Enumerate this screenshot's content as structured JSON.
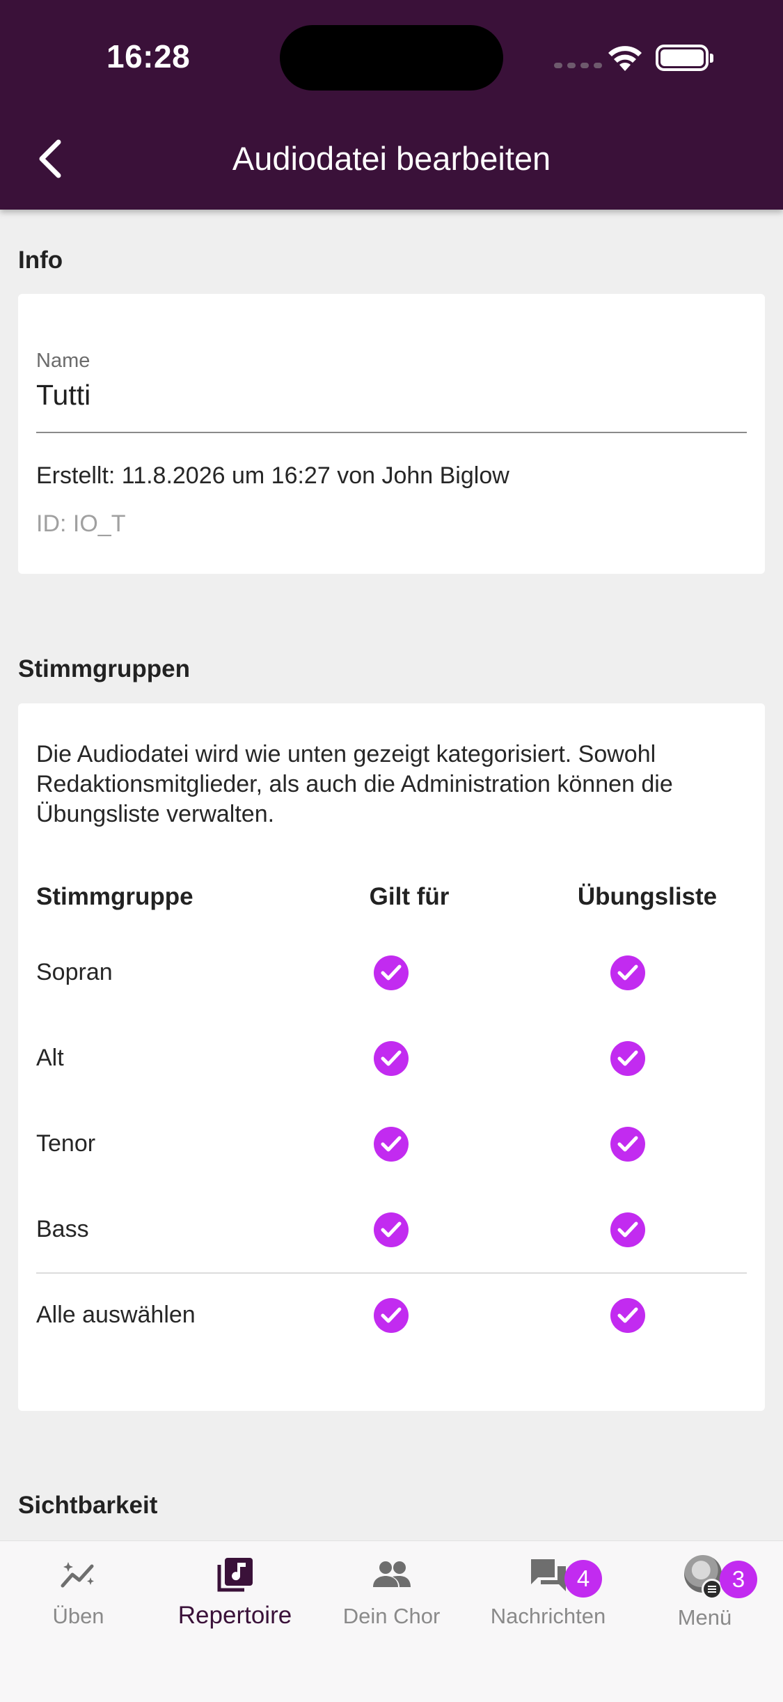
{
  "status_bar": {
    "time": "16:28"
  },
  "header": {
    "title": "Audiodatei bearbeiten"
  },
  "info": {
    "section_title": "Info",
    "name_label": "Name",
    "name_value": "Tutti",
    "created": "Erstellt: 11.8.2026 um 16:27 von John Biglow",
    "id": "ID: IO_T"
  },
  "voices": {
    "section_title": "Stimmgruppen",
    "description": "Die Audiodatei wird wie unten gezeigt kategorisiert. Sowohl Redaktionsmitglieder, als auch die Administration können die Übungsliste verwalten.",
    "columns": [
      "Stimmgruppe",
      "Gilt für",
      "Übungsliste"
    ],
    "rows": [
      {
        "label": "Sopran",
        "applies": true,
        "practice": true
      },
      {
        "label": "Alt",
        "applies": true,
        "practice": true
      },
      {
        "label": "Tenor",
        "applies": true,
        "practice": true
      },
      {
        "label": "Bass",
        "applies": true,
        "practice": true
      },
      {
        "label": "Alle auswählen",
        "applies": true,
        "practice": true
      }
    ]
  },
  "visibility": {
    "section_title": "Sichtbarkeit"
  },
  "bottom_nav": {
    "items": [
      {
        "label": "Üben",
        "icon": "trend-sparkle-icon"
      },
      {
        "label": "Repertoire",
        "icon": "music-library-icon",
        "active": true
      },
      {
        "label": "Dein Chor",
        "icon": "group-icon"
      },
      {
        "label": "Nachrichten",
        "icon": "chat-icon",
        "badge": "4"
      },
      {
        "label": "Menü",
        "icon": "avatar",
        "badge": "3"
      }
    ]
  },
  "colors": {
    "header_bg": "#3a1139",
    "accent": "#c22bf0",
    "page_bg": "#efefef"
  }
}
